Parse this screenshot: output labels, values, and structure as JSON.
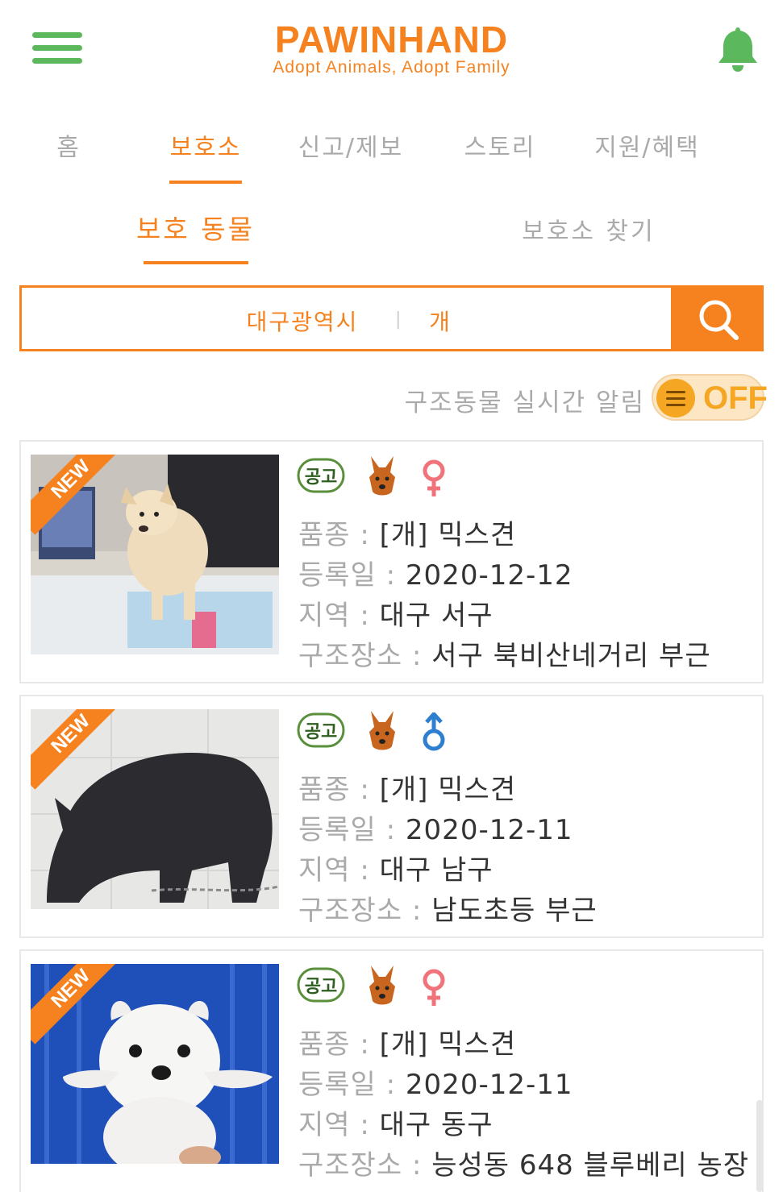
{
  "header": {
    "title": "PAWINHAND",
    "subtitle": "Adopt Animals, Adopt Family"
  },
  "tabs": [
    {
      "label": "홈"
    },
    {
      "label": "보호소"
    },
    {
      "label": "신고/제보"
    },
    {
      "label": "스토리"
    },
    {
      "label": "지원/혜택"
    }
  ],
  "subtabs": [
    {
      "label": "보호 동물"
    },
    {
      "label": "보호소 찾기"
    }
  ],
  "search": {
    "region": "대구광역시",
    "separator": "|",
    "kind": "개"
  },
  "alert": {
    "label": "구조동물 실시간 알림",
    "toggle_text": "OFF"
  },
  "labels": {
    "breed": "품종 : ",
    "date": "등록일 : ",
    "area": "지역 : ",
    "place": "구조장소 : ",
    "new": "NEW",
    "notice": "공고"
  },
  "animals": [
    {
      "breed": "[개] 믹스견",
      "date": "2020-12-12",
      "area": "대구 서구",
      "place": "서구 북비산네거리 부근",
      "sex": "female"
    },
    {
      "breed": "[개] 믹스견",
      "date": "2020-12-11",
      "area": "대구 남구",
      "place": "남도초등 부근",
      "sex": "male"
    },
    {
      "breed": "[개] 믹스견",
      "date": "2020-12-11",
      "area": "대구 동구",
      "place": "능성동 648 블루베리 농장",
      "sex": "female"
    }
  ],
  "colors": {
    "accent": "#f5821f",
    "menu": "#5cb85c",
    "female": "#f0727a",
    "male": "#2f7fd0"
  }
}
